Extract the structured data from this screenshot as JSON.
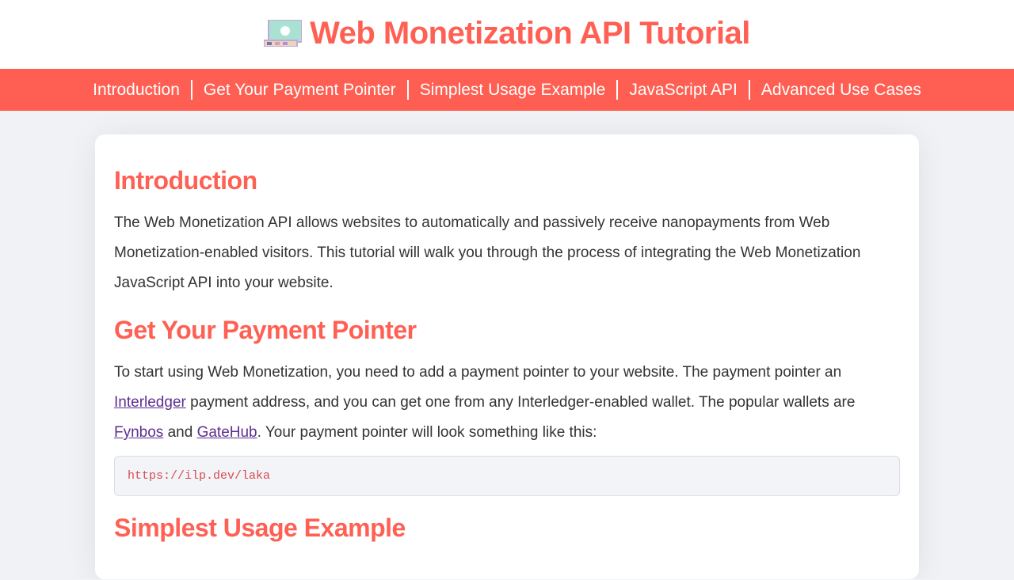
{
  "header": {
    "title": "Web Monetization API Tutorial"
  },
  "nav": {
    "items": [
      {
        "label": "Introduction"
      },
      {
        "label": "Get Your Payment Pointer"
      },
      {
        "label": "Simplest Usage Example"
      },
      {
        "label": "JavaScript API"
      },
      {
        "label": "Advanced Use Cases"
      }
    ]
  },
  "sections": {
    "intro": {
      "heading": "Introduction",
      "body": "The Web Monetization API allows websites to automatically and passively receive nanopayments from Web Monetization-enabled visitors. This tutorial will walk you through the process of integrating the Web Monetization JavaScript API into your website."
    },
    "pointer": {
      "heading": "Get Your Payment Pointer",
      "body_pre_link1": "To start using Web Monetization, you need to add a payment pointer to your website. The payment pointer an ",
      "link1": "Interledger",
      "body_mid1": " payment address, and you can get one from any Interledger-enabled wallet. The popular wallets are ",
      "link2": "Fynbos",
      "body_mid2": " and ",
      "link3": "GateHub",
      "body_tail": ". Your payment pointer will look something like this:",
      "code": "https://ilp.dev/laka"
    },
    "example": {
      "heading": "Simplest Usage Example"
    }
  }
}
